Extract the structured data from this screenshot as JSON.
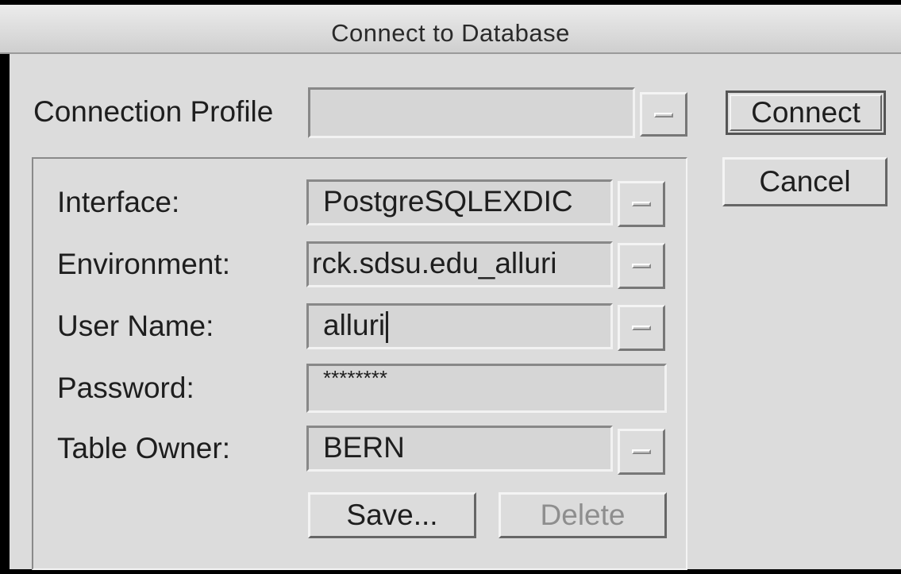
{
  "window": {
    "title": "Connect to Database"
  },
  "profile": {
    "label": "Connection Profile",
    "value": ""
  },
  "buttons": {
    "connect": "Connect",
    "cancel": "Cancel",
    "save": "Save...",
    "delete": "Delete"
  },
  "form": {
    "interface": {
      "label": "Interface:",
      "value": "PostgreSQLEXDIC"
    },
    "environment": {
      "label": "Environment:",
      "value": "rck.sdsu.edu_alluri"
    },
    "user_name": {
      "label": "User Name:",
      "value": "alluri"
    },
    "password": {
      "label": "Password:",
      "value": "********"
    },
    "table_owner": {
      "label": "Table Owner:",
      "value": "BERN"
    }
  },
  "colors": {
    "window_bg": "#dcdcdc",
    "disabled_text": "#8e8e8e"
  },
  "icons": {
    "dropdown": "dropdown-arrow-icon",
    "text_cursor": "text-cursor-icon"
  }
}
